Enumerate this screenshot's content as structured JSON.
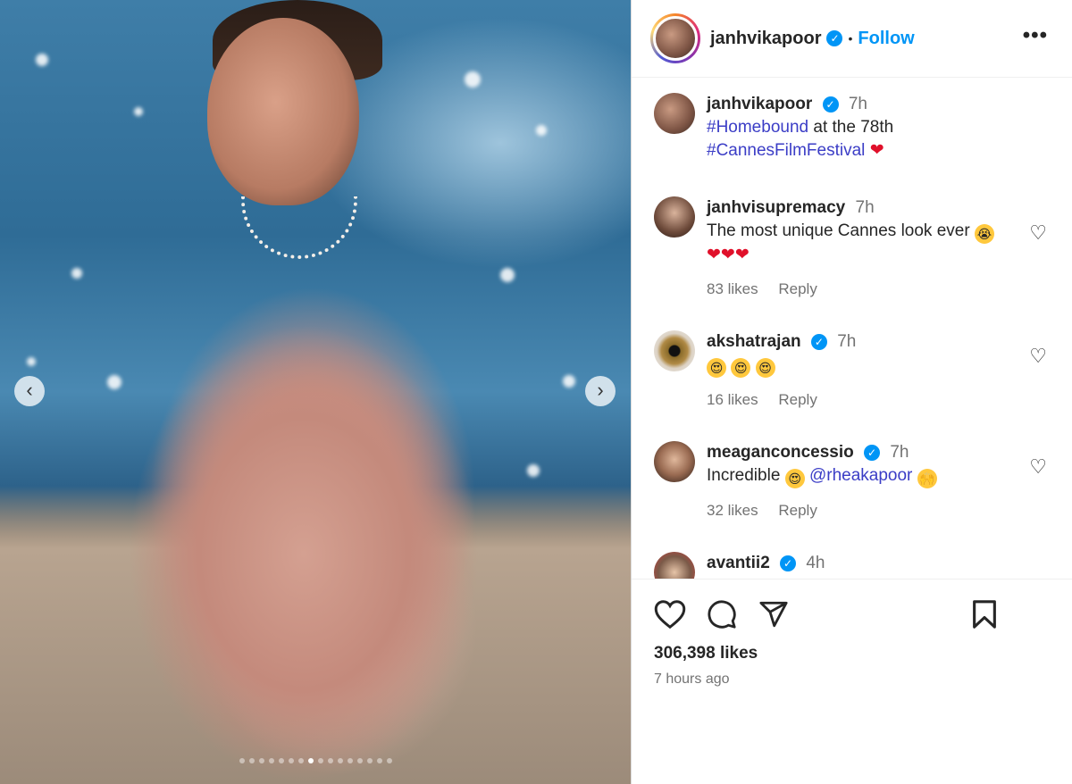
{
  "post": {
    "carousel": {
      "total": 16,
      "active": 7
    },
    "media_alt": "Woman in a pleated blush gown with pearl necklace sitting by the sea"
  },
  "header": {
    "username": "janhvikapoor",
    "separator": "•",
    "follow_label": "Follow",
    "more_label": "•••"
  },
  "caption": {
    "username": "janhvikapoor",
    "time": "7h",
    "tag1": "#Homebound",
    "text_mid": " at the 78th",
    "tag2": "#CannesFilmFestival",
    "emoji": "❤"
  },
  "comments": [
    {
      "username": "janhvisupremacy",
      "time": "7h",
      "text": "The most unique Cannes look ever",
      "emoji_line": "❤❤❤",
      "likes": "83 likes",
      "reply": "Reply"
    },
    {
      "username": "akshatrajan",
      "time": "7h",
      "text": "",
      "likes": "16 likes",
      "reply": "Reply"
    },
    {
      "username": "meaganconcessio",
      "time": "7h",
      "text": "Incredible",
      "mention": "@rheakapoor",
      "likes": "32 likes",
      "reply": "Reply"
    },
    {
      "username": "avantii2",
      "time": "4h"
    }
  ],
  "footer": {
    "likes": "306,398 likes",
    "time_ago": "7 hours ago"
  },
  "colors": {
    "accent": "#0095f6",
    "hashtag": "#3b3dc6",
    "muted": "#737373"
  }
}
